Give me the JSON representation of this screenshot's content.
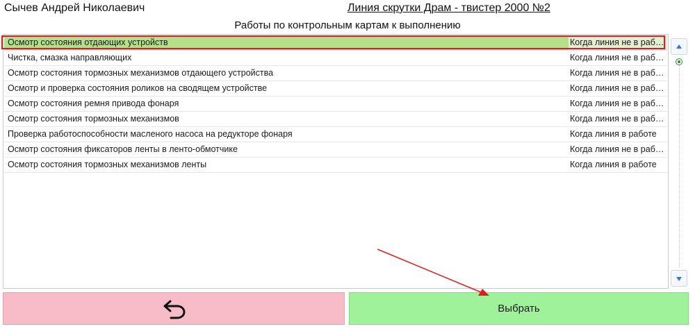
{
  "header": {
    "user_name": "Сычев Андрей Николаевич",
    "line_title": "Линия скрутки Драм - твистер 2000 №2"
  },
  "list_title": "Работы по контрольным картам к выполнению",
  "rows": [
    {
      "name": "Осмотр состояния отдающих устройств",
      "when": "Когда линия не в работе",
      "selected": true
    },
    {
      "name": "Чистка, смазка направляющих",
      "when": "Когда линия не в работе",
      "selected": false
    },
    {
      "name": "Осмотр состояния тормозных механизмов отдающего устройства",
      "when": "Когда линия не в работе",
      "selected": false
    },
    {
      "name": "Осмотр и проверка состояния роликов на сводящем устройстве",
      "when": "Когда линия не в работе",
      "selected": false
    },
    {
      "name": "Осмотр состояния ремня привода фонаря",
      "when": "Когда линия не в работе",
      "selected": false
    },
    {
      "name": "Осмотр состояния тормозных механизмов",
      "when": "Когда линия не в работе",
      "selected": false
    },
    {
      "name": "Проверка работоспособности масленого насоса на редукторе фонаря",
      "when": "Когда линия в работе",
      "selected": false
    },
    {
      "name": "Осмотр состояния фиксаторов ленты в ленто-обмотчике",
      "when": "Когда линия не в работе",
      "selected": false
    },
    {
      "name": "Осмотр состояния тормозных механизмов ленты",
      "when": "Когда линия в работе",
      "selected": false
    }
  ],
  "buttons": {
    "back_icon": "undo-arrow-icon",
    "select_label": "Выбрать"
  },
  "colors": {
    "selected_row": "#b5e08a",
    "selection_outline": "#e11b1b",
    "back_button": "#f7bcc8",
    "select_button": "#9ff29a",
    "annotation_arrow": "#e11b1b"
  }
}
